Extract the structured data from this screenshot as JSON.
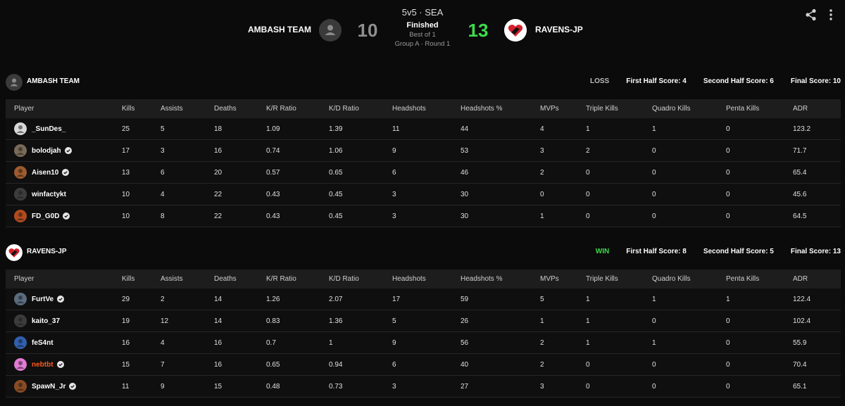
{
  "header": {
    "format": "5v5 · SEA",
    "status": "Finished",
    "best_of": "Best of 1",
    "round": "Group A · Round 1",
    "team1": {
      "name": "AMBASH TEAM",
      "score": "10"
    },
    "team2": {
      "name": "RAVENS-JP",
      "score": "13"
    }
  },
  "colors": {
    "win": "#3ddc4c",
    "loss_score": "#8f8f8f",
    "highlight_player": "#ff5a1f",
    "table_header_bg": "#1d1d1d"
  },
  "icons": {
    "share": "share-icon",
    "more": "more-vertical-icon",
    "verified": "verified-badge-icon"
  },
  "columns": [
    "Player",
    "Kills",
    "Assists",
    "Deaths",
    "K/R Ratio",
    "K/D Ratio",
    "Headshots",
    "Headshots %",
    "MVPs",
    "Triple Kills",
    "Quadro Kills",
    "Penta Kills",
    "ADR"
  ],
  "teams": [
    {
      "name": "AMBASH TEAM",
      "result": "LOSS",
      "first_half": "First Half Score: 4",
      "second_half": "Second Half Score: 6",
      "final": "Final Score: 10",
      "players": [
        {
          "name": "_SunDes_",
          "verified": false,
          "highlight": false,
          "stats": [
            "25",
            "5",
            "18",
            "1.09",
            "1.39",
            "11",
            "44",
            "4",
            "1",
            "1",
            "0",
            "123.2"
          ]
        },
        {
          "name": "bolodjah",
          "verified": true,
          "highlight": false,
          "stats": [
            "17",
            "3",
            "16",
            "0.74",
            "1.06",
            "9",
            "53",
            "3",
            "2",
            "0",
            "0",
            "71.7"
          ]
        },
        {
          "name": "Aisen10",
          "verified": true,
          "highlight": false,
          "stats": [
            "13",
            "6",
            "20",
            "0.57",
            "0.65",
            "6",
            "46",
            "2",
            "0",
            "0",
            "0",
            "65.4"
          ]
        },
        {
          "name": "winfactykt",
          "verified": false,
          "highlight": false,
          "stats": [
            "10",
            "4",
            "22",
            "0.43",
            "0.45",
            "3",
            "30",
            "0",
            "0",
            "0",
            "0",
            "45.6"
          ]
        },
        {
          "name": "FD_G0D",
          "verified": true,
          "highlight": false,
          "stats": [
            "10",
            "8",
            "22",
            "0.43",
            "0.45",
            "3",
            "30",
            "1",
            "0",
            "0",
            "0",
            "64.5"
          ]
        }
      ]
    },
    {
      "name": "RAVENS-JP",
      "result": "WIN",
      "first_half": "First Half Score: 8",
      "second_half": "Second Half Score: 5",
      "final": "Final Score: 13",
      "players": [
        {
          "name": "FurtVe",
          "verified": true,
          "highlight": false,
          "stats": [
            "29",
            "2",
            "14",
            "1.26",
            "2.07",
            "17",
            "59",
            "5",
            "1",
            "1",
            "1",
            "122.4"
          ]
        },
        {
          "name": "kaito_37",
          "verified": false,
          "highlight": false,
          "stats": [
            "19",
            "12",
            "14",
            "0.83",
            "1.36",
            "5",
            "26",
            "1",
            "1",
            "0",
            "0",
            "102.4"
          ]
        },
        {
          "name": "feS4nt",
          "verified": false,
          "highlight": false,
          "stats": [
            "16",
            "4",
            "16",
            "0.7",
            "1",
            "9",
            "56",
            "2",
            "1",
            "1",
            "0",
            "55.9"
          ]
        },
        {
          "name": "nebtbt",
          "verified": true,
          "highlight": true,
          "stats": [
            "15",
            "7",
            "16",
            "0.65",
            "0.94",
            "6",
            "40",
            "2",
            "0",
            "0",
            "0",
            "70.4"
          ]
        },
        {
          "name": "SpawN_Jr",
          "verified": true,
          "highlight": false,
          "stats": [
            "11",
            "9",
            "15",
            "0.48",
            "0.73",
            "3",
            "27",
            "3",
            "0",
            "0",
            "0",
            "65.1"
          ]
        }
      ]
    }
  ]
}
